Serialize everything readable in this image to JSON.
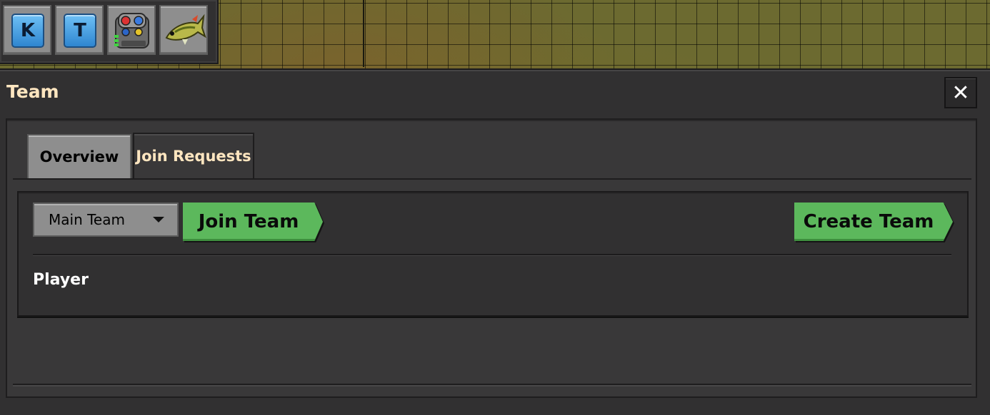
{
  "shortcut_bar": {
    "slots": [
      {
        "label": "K",
        "icon": "key-k-icon"
      },
      {
        "label": "T",
        "icon": "key-t-icon"
      },
      {
        "label": "",
        "icon": "combinator-icon"
      },
      {
        "label": "",
        "icon": "fish-icon"
      }
    ]
  },
  "team_window": {
    "title": "Team",
    "close_label": "✕",
    "tabs": [
      {
        "label": "Overview",
        "selected": false
      },
      {
        "label": "Join Requests",
        "selected": true
      }
    ],
    "team_dropdown": {
      "selected": "Main Team"
    },
    "join_button": "Join Team",
    "create_button": "Create Team",
    "players": [
      "Player"
    ]
  },
  "colors": {
    "title": "#ffe6c0",
    "green_button": "#5cb85c",
    "frame": "#313031"
  }
}
